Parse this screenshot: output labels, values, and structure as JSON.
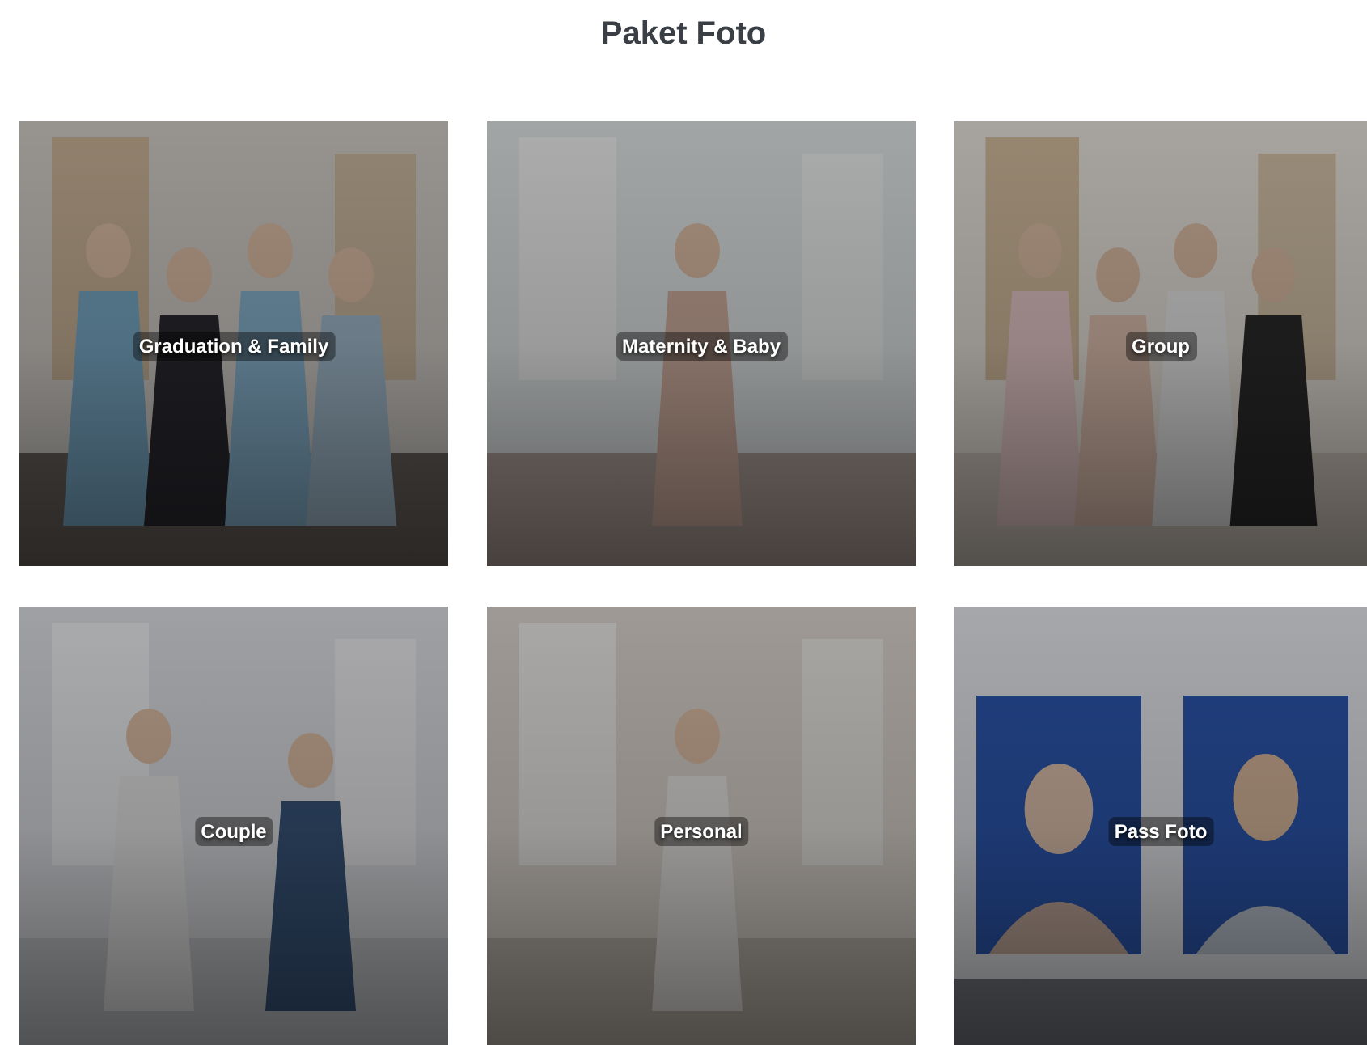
{
  "title": "Paket Foto",
  "packages": [
    {
      "label": "Graduation & Family"
    },
    {
      "label": "Maternity & Baby"
    },
    {
      "label": "Group"
    },
    {
      "label": "Couple"
    },
    {
      "label": "Personal"
    },
    {
      "label": "Pass Foto"
    }
  ]
}
